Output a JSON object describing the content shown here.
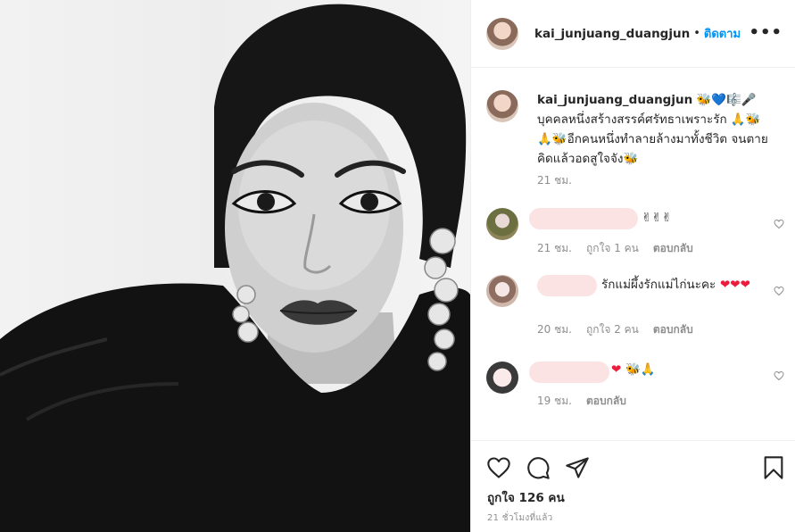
{
  "post": {
    "username": "kai_junjuang_duangjun",
    "separator": "•",
    "follow_label": "ติดตาม",
    "more_label": "•••"
  },
  "caption": {
    "username": "kai_junjuang_duangjun",
    "prefix_emoji": "🐝💙🎼🎤",
    "text_1": "บุคคลหนึ่งสร้างสรรค์ศรัทธาเพราะรัก ",
    "emoji_1": "🙏🐝🙏🐝",
    "text_2": "อีกคนหนึ่งทำลายล้างมาทั้งชีวิต จนตาย คิดแล้วอดสูใจจัง",
    "emoji_2": "🐝",
    "time": "21 ชม."
  },
  "comments": [
    {
      "text": "✌✌✌",
      "time": "21 ชม.",
      "likes": "ถูกใจ 1 คน",
      "reply": "ตอบกลับ"
    },
    {
      "text": "รักแม่ผึ้งรักแม่ไก่นะคะ",
      "hearts": "❤❤❤",
      "time": "20 ชม.",
      "likes": "ถูกใจ 2 คน",
      "reply": "ตอบกลับ"
    },
    {
      "hearts": "❤",
      "emoji": "🐝🙏",
      "time": "19 ชม.",
      "reply": "ตอบกลับ"
    }
  ],
  "footer": {
    "likes": "ถูกใจ 126 คน",
    "ago": "21 ชั่วโมงที่แล้ว"
  },
  "icons": {
    "like": "heart-icon",
    "comment": "comment-icon",
    "share": "share-icon",
    "save": "bookmark-icon"
  }
}
